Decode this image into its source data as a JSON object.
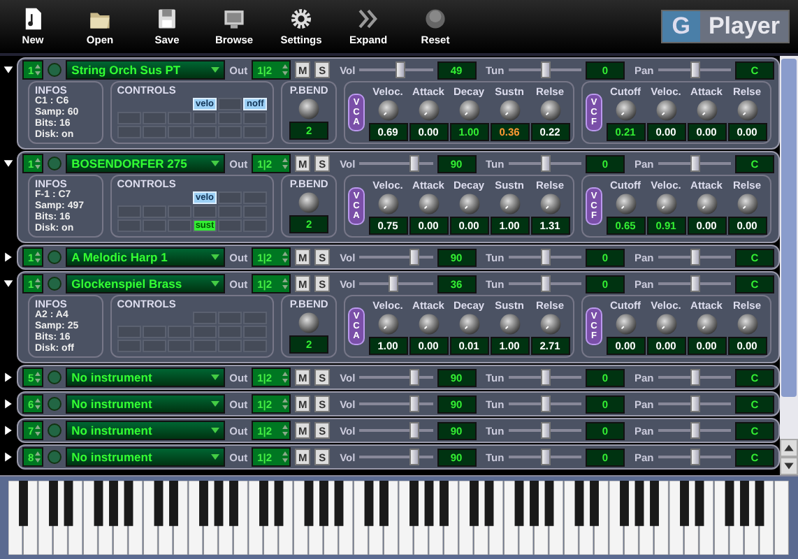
{
  "toolbar": [
    {
      "kind": "new",
      "label": "New"
    },
    {
      "kind": "open",
      "label": "Open"
    },
    {
      "kind": "save",
      "label": "Save"
    },
    {
      "kind": "browse",
      "label": "Browse"
    },
    {
      "kind": "settings",
      "label": "Settings"
    },
    {
      "kind": "expand",
      "label": "Expand"
    },
    {
      "kind": "reset",
      "label": "Reset"
    }
  ],
  "logo": {
    "letter": "G",
    "name": "Player"
  },
  "channels": [
    {
      "expanded": true,
      "number": "1",
      "instrument": "String Orch Sus PT",
      "out_label": "Out",
      "out": "1|2",
      "mute": "M",
      "solo": "S",
      "vol": {
        "label": "Vol",
        "level": 0.55,
        "reading": "49"
      },
      "tun": {
        "label": "Tun",
        "level": 0.5,
        "reading": "0"
      },
      "pan": {
        "label": "Pan",
        "level": 0.5,
        "reading": "C"
      },
      "infos": {
        "title": "INFOS",
        "lines": [
          "C1 : C6",
          "Samp: 60",
          "Bits: 16",
          "Disk: on"
        ]
      },
      "controls": {
        "title": "CONTROLS",
        "cells": [
          {
            "label": "velo",
            "on": true
          },
          {
            "on": false
          },
          {
            "label": "noff",
            "on": true
          },
          {
            "on": false
          },
          {
            "on": false
          },
          {
            "on": false
          },
          {
            "on": false
          },
          {
            "on": false
          },
          {
            "on": false
          },
          {
            "on": false
          },
          {
            "on": false
          },
          {
            "on": false
          },
          {
            "on": false
          },
          {
            "on": false
          },
          {
            "on": false
          }
        ]
      },
      "pbend": {
        "title": "P.BEND",
        "value": "2"
      },
      "vca": {
        "tag": "VCA",
        "knobs": [
          {
            "label": "Veloc.",
            "value": "0.69",
            "kind": "plain"
          },
          {
            "label": "Attack",
            "value": "0.00",
            "kind": "plain"
          },
          {
            "label": "Decay",
            "value": "1.00",
            "kind": "active"
          },
          {
            "label": "Sustn",
            "value": "0.36",
            "kind": "warning"
          },
          {
            "label": "Relse",
            "value": "0.22",
            "kind": "plain"
          }
        ]
      },
      "vcf": {
        "tag": "VCF",
        "knobs": [
          {
            "label": "Cutoff",
            "value": "0.21",
            "kind": "active"
          },
          {
            "label": "Veloc.",
            "value": "0.00",
            "kind": "plain"
          },
          {
            "label": "Attack",
            "value": "0.00",
            "kind": "plain"
          },
          {
            "label": "Relse",
            "value": "0.00",
            "kind": "plain"
          }
        ]
      }
    },
    {
      "expanded": true,
      "number": "1",
      "instrument": "BOSENDORFER 275",
      "out_label": "Out",
      "out": "1|2",
      "mute": "M",
      "solo": "S",
      "vol": {
        "label": "Vol",
        "level": 0.75,
        "reading": "90"
      },
      "tun": {
        "label": "Tun",
        "level": 0.5,
        "reading": "0"
      },
      "pan": {
        "label": "Pan",
        "level": 0.5,
        "reading": "C"
      },
      "infos": {
        "title": "INFOS",
        "lines": [
          "F-1 : C7",
          "Samp: 497",
          "Bits: 16",
          "Disk: on"
        ]
      },
      "controls": {
        "title": "CONTROLS",
        "cells": [
          {
            "label": "velo",
            "on": true
          },
          {
            "on": false
          },
          {
            "on": false
          },
          {
            "on": false
          },
          {
            "on": false
          },
          {
            "on": false
          },
          {
            "on": false
          },
          {
            "on": false
          },
          {
            "on": false
          },
          {
            "on": false
          },
          {
            "on": false
          },
          {
            "on": false
          },
          {
            "label": "sust",
            "on": true
          },
          {
            "on": false
          },
          {
            "on": false
          }
        ]
      },
      "pbend": {
        "title": "P.BEND",
        "value": "2"
      },
      "vca": {
        "tag": "VCA",
        "knobs": [
          {
            "label": "Veloc.",
            "value": "0.75",
            "kind": "plain"
          },
          {
            "label": "Attack",
            "value": "0.00",
            "kind": "plain"
          },
          {
            "label": "Decay",
            "value": "0.00",
            "kind": "plain"
          },
          {
            "label": "Sustn",
            "value": "1.00",
            "kind": "plain"
          },
          {
            "label": "Relse",
            "value": "1.31",
            "kind": "plain"
          }
        ]
      },
      "vcf": {
        "tag": "VCF",
        "knobs": [
          {
            "label": "Cutoff",
            "value": "0.65",
            "kind": "active"
          },
          {
            "label": "Veloc.",
            "value": "0.91",
            "kind": "active"
          },
          {
            "label": "Attack",
            "value": "0.00",
            "kind": "plain"
          },
          {
            "label": "Relse",
            "value": "0.00",
            "kind": "plain"
          }
        ]
      }
    },
    {
      "expanded": false,
      "number": "1",
      "instrument": "A Melodic Harp 1",
      "out_label": "Out",
      "out": "1|2",
      "mute": "M",
      "solo": "S",
      "vol": {
        "label": "Vol",
        "level": 0.75,
        "reading": "90"
      },
      "tun": {
        "label": "Tun",
        "level": 0.5,
        "reading": "0"
      },
      "pan": {
        "label": "Pan",
        "level": 0.5,
        "reading": "C"
      }
    },
    {
      "expanded": true,
      "number": "1",
      "instrument": "Glockenspiel Brass",
      "out_label": "Out",
      "out": "1|2",
      "mute": "M",
      "solo": "S",
      "vol": {
        "label": "Vol",
        "level": 0.45,
        "reading": "36"
      },
      "tun": {
        "label": "Tun",
        "level": 0.5,
        "reading": "0"
      },
      "pan": {
        "label": "Pan",
        "level": 0.5,
        "reading": "C"
      },
      "infos": {
        "title": "INFOS",
        "lines": [
          "A2 : A4",
          "Samp: 25",
          "Bits: 16",
          "Disk: off"
        ]
      },
      "controls": {
        "title": "CONTROLS",
        "cells": [
          {
            "on": false
          },
          {
            "on": false
          },
          {
            "on": false
          },
          {
            "on": false
          },
          {
            "on": false
          },
          {
            "on": false
          },
          {
            "on": false
          },
          {
            "on": false
          },
          {
            "on": false
          },
          {
            "on": false
          },
          {
            "on": false
          },
          {
            "on": false
          },
          {
            "on": false
          },
          {
            "on": false
          },
          {
            "on": false
          }
        ]
      },
      "pbend": {
        "title": "P.BEND",
        "value": "2"
      },
      "vca": {
        "tag": "VCA",
        "knobs": [
          {
            "label": "Veloc.",
            "value": "1.00",
            "kind": "plain"
          },
          {
            "label": "Attack",
            "value": "0.00",
            "kind": "plain"
          },
          {
            "label": "Decay",
            "value": "0.01",
            "kind": "plain"
          },
          {
            "label": "Sustn",
            "value": "1.00",
            "kind": "plain"
          },
          {
            "label": "Relse",
            "value": "2.71",
            "kind": "plain"
          }
        ]
      },
      "vcf": {
        "tag": "VCF",
        "knobs": [
          {
            "label": "Cutoff",
            "value": "0.00",
            "kind": "plain"
          },
          {
            "label": "Veloc.",
            "value": "0.00",
            "kind": "plain"
          },
          {
            "label": "Attack",
            "value": "0.00",
            "kind": "plain"
          },
          {
            "label": "Relse",
            "value": "0.00",
            "kind": "plain"
          }
        ]
      }
    },
    {
      "expanded": false,
      "number": "5",
      "instrument": "No instrument",
      "out_label": "Out",
      "out": "1|2",
      "mute": "M",
      "solo": "S",
      "vol": {
        "label": "Vol",
        "level": 0.75,
        "reading": "90"
      },
      "tun": {
        "label": "Tun",
        "level": 0.5,
        "reading": "0"
      },
      "pan": {
        "label": "Pan",
        "level": 0.5,
        "reading": "C"
      }
    },
    {
      "expanded": false,
      "number": "6",
      "instrument": "No instrument",
      "out_label": "Out",
      "out": "1|2",
      "mute": "M",
      "solo": "S",
      "vol": {
        "label": "Vol",
        "level": 0.75,
        "reading": "90"
      },
      "tun": {
        "label": "Tun",
        "level": 0.5,
        "reading": "0"
      },
      "pan": {
        "label": "Pan",
        "level": 0.5,
        "reading": "C"
      }
    },
    {
      "expanded": false,
      "number": "7",
      "instrument": "No instrument",
      "out_label": "Out",
      "out": "1|2",
      "mute": "M",
      "solo": "S",
      "vol": {
        "label": "Vol",
        "level": 0.75,
        "reading": "90"
      },
      "tun": {
        "label": "Tun",
        "level": 0.5,
        "reading": "0"
      },
      "pan": {
        "label": "Pan",
        "level": 0.5,
        "reading": "C"
      }
    },
    {
      "expanded": false,
      "number": "8",
      "instrument": "No instrument",
      "out_label": "Out",
      "out": "1|2",
      "mute": "M",
      "solo": "S",
      "vol": {
        "label": "Vol",
        "level": 0.75,
        "reading": "90"
      },
      "tun": {
        "label": "Tun",
        "level": 0.5,
        "reading": "0"
      },
      "pan": {
        "label": "Pan",
        "level": 0.5,
        "reading": "C"
      }
    }
  ]
}
